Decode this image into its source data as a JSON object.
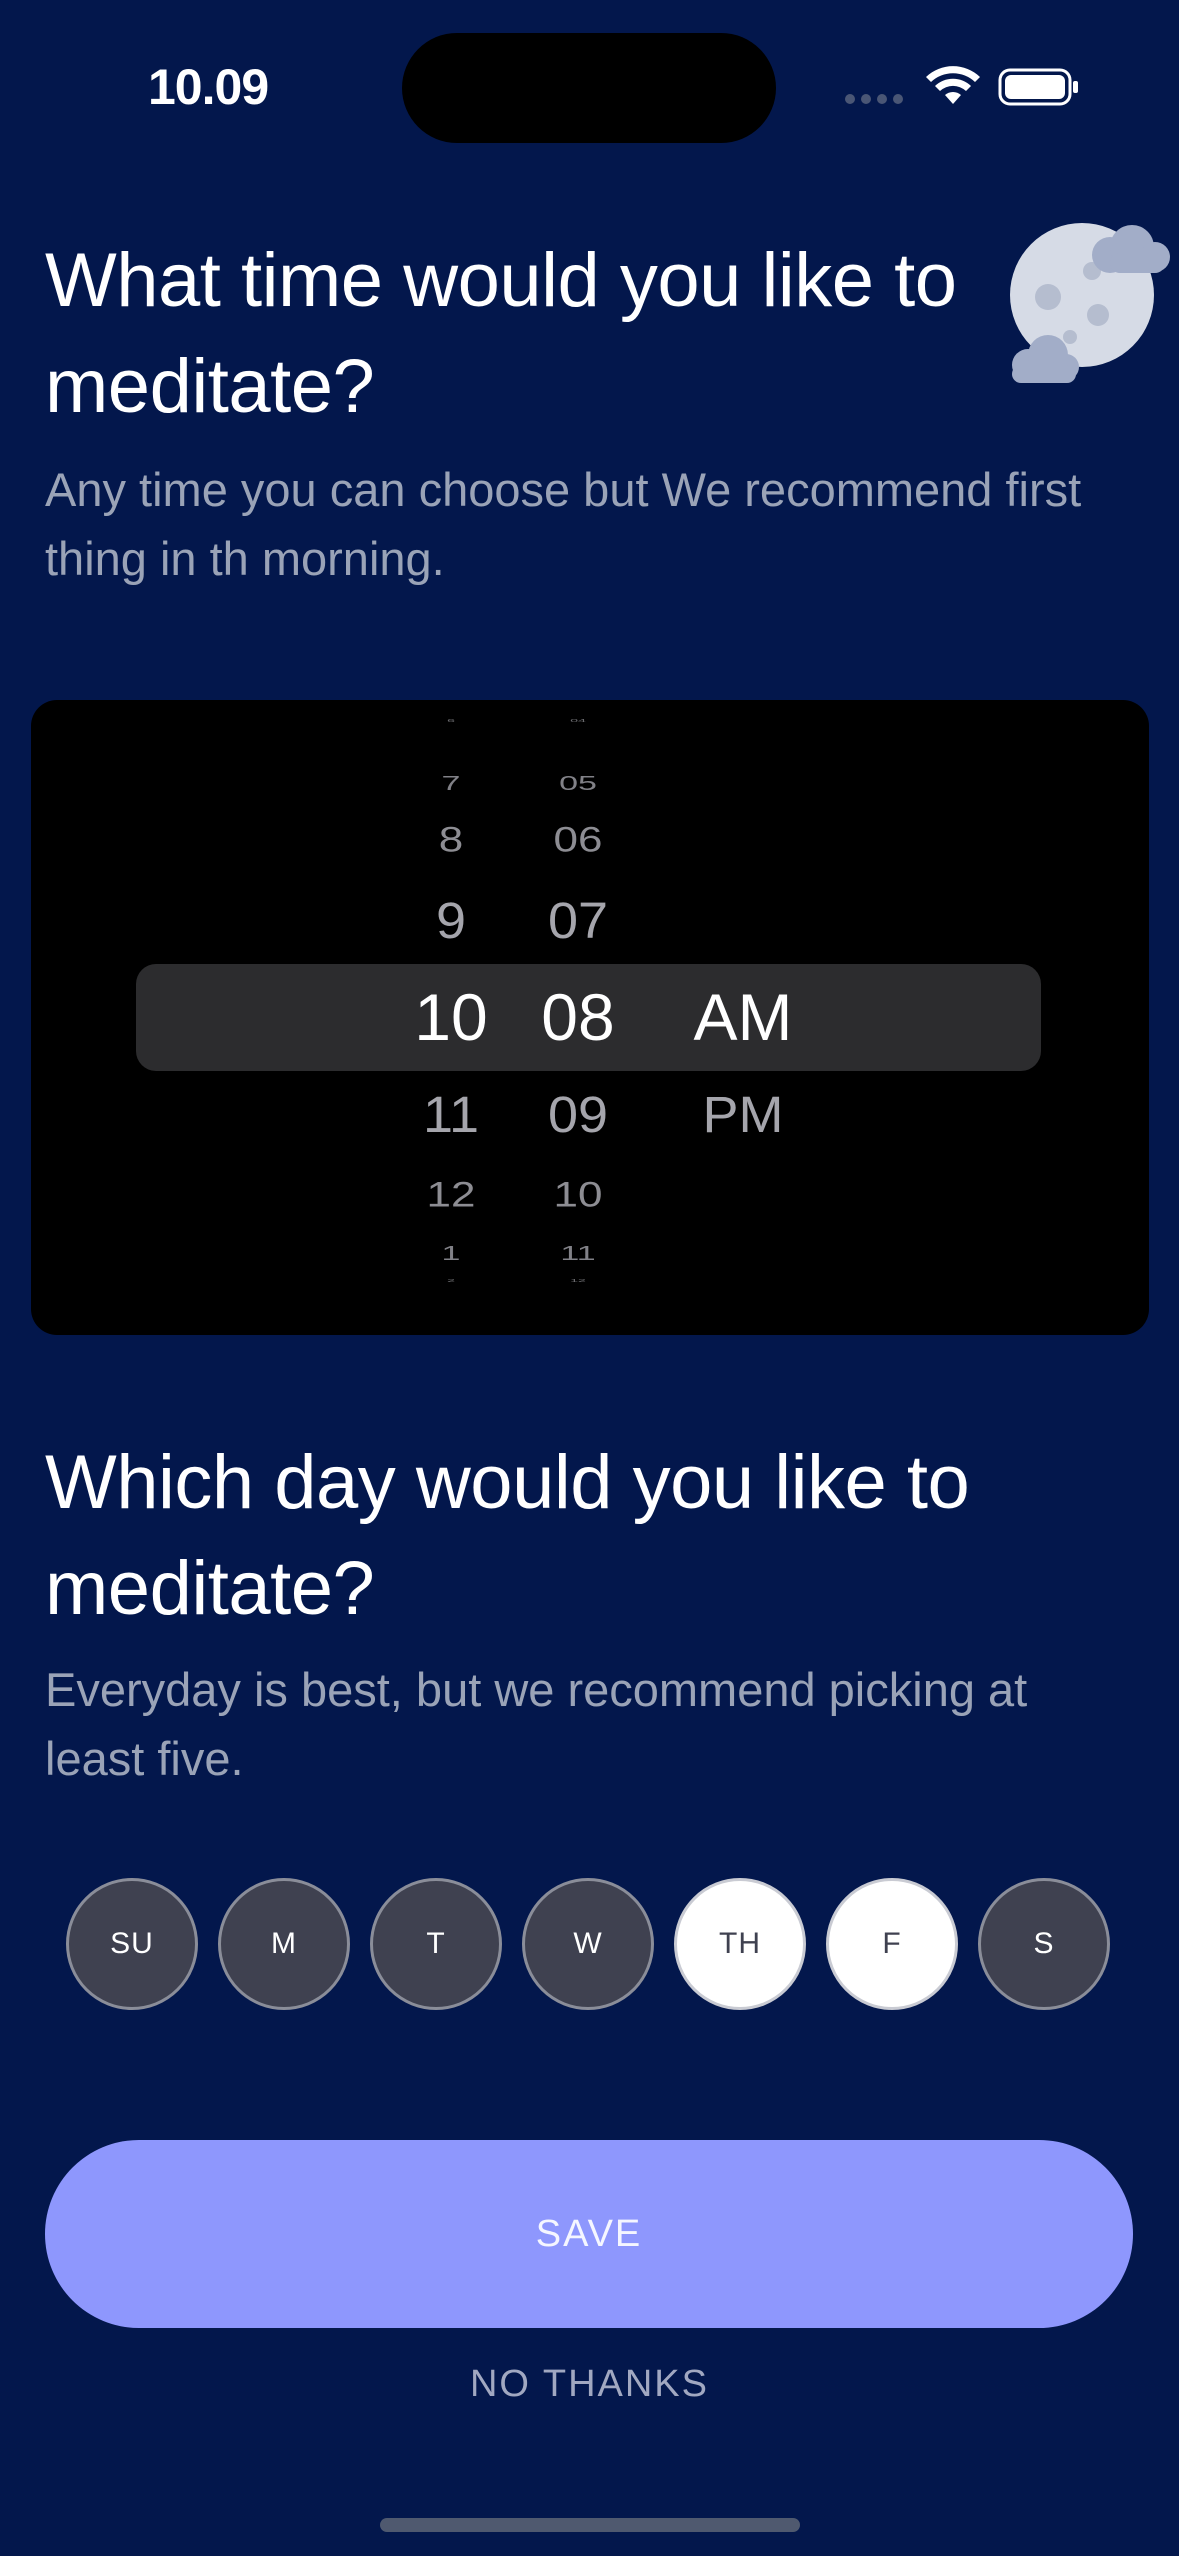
{
  "status": {
    "time": "10.09",
    "icons": [
      "signal-dots-icon",
      "wifi-icon",
      "battery-icon"
    ]
  },
  "time_section": {
    "title_line1": "What time would you like to",
    "title_line2": "meditate?",
    "subtitle_line1": "Any time you can choose but We recommend first",
    "subtitle_line2": "thing in th morning.",
    "illustration": "moon-clouds-icon"
  },
  "picker": {
    "hours": [
      "6",
      "7",
      "8",
      "9",
      "10",
      "11",
      "12",
      "1",
      "2"
    ],
    "minutes": [
      "04",
      "05",
      "06",
      "07",
      "08",
      "09",
      "10",
      "11",
      "12"
    ],
    "periods": [
      "AM",
      "PM"
    ],
    "selected": {
      "hour": "10",
      "minute": "08",
      "period": "AM"
    }
  },
  "day_section": {
    "title_line1": "Which day would you like to",
    "title_line2": "meditate?",
    "subtitle_line1": "Everyday is best, but we recommend picking at",
    "subtitle_line2": "least five."
  },
  "days": [
    {
      "label": "SU",
      "selected": false
    },
    {
      "label": "M",
      "selected": false
    },
    {
      "label": "T",
      "selected": false
    },
    {
      "label": "W",
      "selected": false
    },
    {
      "label": "TH",
      "selected": true
    },
    {
      "label": "F",
      "selected": true
    },
    {
      "label": "S",
      "selected": false
    }
  ],
  "actions": {
    "save_label": "SAVE",
    "no_thanks_label": "NO THANKS"
  },
  "colors": {
    "background": "#03174C",
    "accent": "#8E97FD",
    "day_unselected": "#3F4150",
    "day_selected": "#FFFFFF"
  }
}
